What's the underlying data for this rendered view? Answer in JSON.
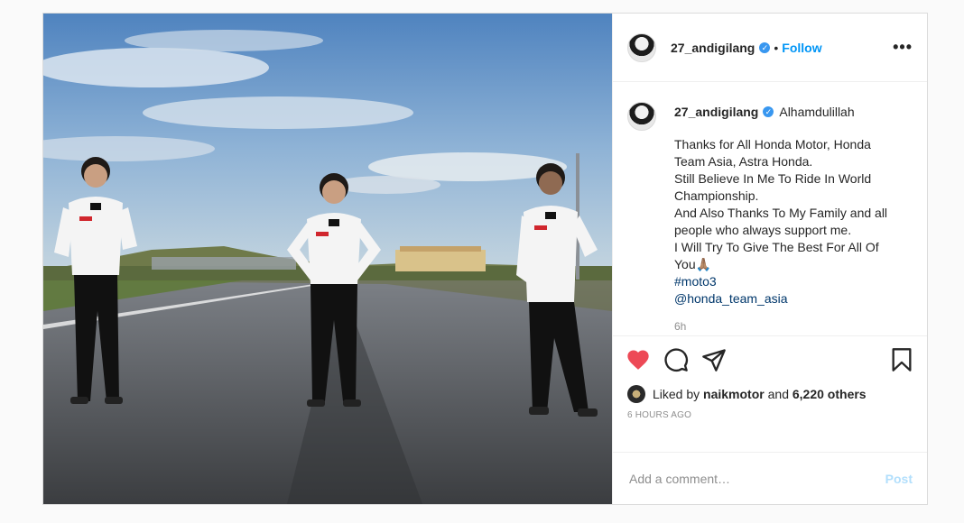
{
  "post": {
    "username": "27_andigilang",
    "verified_icon": "verified-badge-icon",
    "separator": "•",
    "follow_label": "Follow",
    "more_label": "•••",
    "caption": {
      "first_line": "Alhamdulillah",
      "lines": [
        "Thanks for All Honda Motor, Honda",
        "Team Asia, Astra Honda.",
        "Still Believe In Me To Ride In World",
        "Championship.",
        "And Also Thanks To My Family and all",
        "people who always support me.",
        "I Will Try To Give The Best For All Of",
        "You🙏🏽"
      ],
      "hashtag": "#moto3",
      "mention": "@honda_team_asia",
      "time": "6h"
    },
    "actions": {
      "like_icon": "heart-icon",
      "comment_icon": "comment-icon",
      "share_icon": "share-icon",
      "save_icon": "bookmark-icon",
      "like_color": "#ed4956"
    },
    "likes": {
      "prefix": "Liked by",
      "user": "naikmotor",
      "and": "and",
      "others": "6,220 others"
    },
    "ago": "6 HOURS AGO",
    "comment": {
      "placeholder": "Add a comment…",
      "post_label": "Post"
    }
  }
}
